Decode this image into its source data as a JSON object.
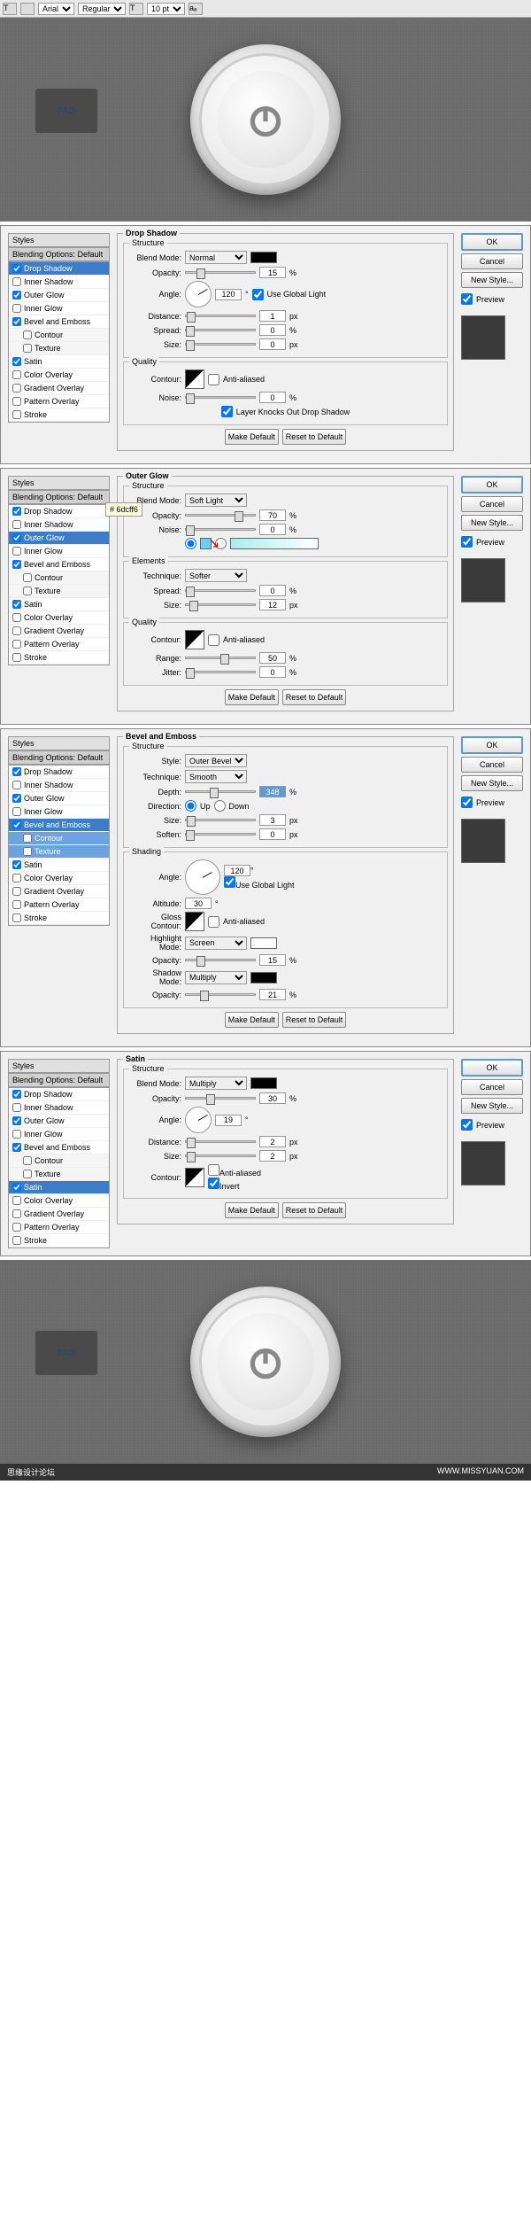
{
  "toolbar": {
    "font": "Arial",
    "weight": "Regular",
    "size": "10 pt"
  },
  "fad": "FAD",
  "panels": [
    {
      "title": "Drop Shadow",
      "active": "Drop Shadow",
      "tooltip": "",
      "styles": [
        {
          "n": "Drop Shadow",
          "c": true,
          "a": true
        },
        {
          "n": "Inner Shadow",
          "c": false
        },
        {
          "n": "Outer Glow",
          "c": true
        },
        {
          "n": "Inner Glow",
          "c": false
        },
        {
          "n": "Bevel and Emboss",
          "c": true
        },
        {
          "n": "Contour",
          "c": false,
          "s": true
        },
        {
          "n": "Texture",
          "c": false,
          "s": true
        },
        {
          "n": "Satin",
          "c": true
        },
        {
          "n": "Color Overlay",
          "c": false
        },
        {
          "n": "Gradient Overlay",
          "c": false
        },
        {
          "n": "Pattern Overlay",
          "c": false
        },
        {
          "n": "Stroke",
          "c": false
        }
      ],
      "struct": {
        "mode": "Normal",
        "opacity": "15",
        "angle": "120",
        "gl": true,
        "dist": "1",
        "spread": "0",
        "size": "0"
      },
      "quality": {
        "noise": "0",
        "knock": true
      }
    },
    {
      "title": "Outer Glow",
      "active": "Outer Glow",
      "tooltip": "# 6dcff6",
      "arrow": true,
      "styles": [
        {
          "n": "Drop Shadow",
          "c": true
        },
        {
          "n": "Inner Shadow",
          "c": false
        },
        {
          "n": "Outer Glow",
          "c": true,
          "a": true
        },
        {
          "n": "Inner Glow",
          "c": false
        },
        {
          "n": "Bevel and Emboss",
          "c": true
        },
        {
          "n": "Contour",
          "c": false,
          "s": true
        },
        {
          "n": "Texture",
          "c": false,
          "s": true
        },
        {
          "n": "Satin",
          "c": true
        },
        {
          "n": "Color Overlay",
          "c": false
        },
        {
          "n": "Gradient Overlay",
          "c": false
        },
        {
          "n": "Pattern Overlay",
          "c": false
        },
        {
          "n": "Stroke",
          "c": false
        }
      ],
      "struct": {
        "mode": "Soft Light",
        "opacity": "70",
        "noise": "0",
        "color": "#6dcff6"
      },
      "elem": {
        "tech": "Softer",
        "spread": "0",
        "size": "12"
      },
      "quality": {
        "range": "50",
        "jitter": "0"
      }
    },
    {
      "title": "Bevel and Emboss",
      "active": "Bevel and Emboss",
      "styles": [
        {
          "n": "Drop Shadow",
          "c": true
        },
        {
          "n": "Inner Shadow",
          "c": false
        },
        {
          "n": "Outer Glow",
          "c": true
        },
        {
          "n": "Inner Glow",
          "c": false
        },
        {
          "n": "Bevel and Emboss",
          "c": true,
          "a": true
        },
        {
          "n": "Contour",
          "c": false,
          "s": true,
          "a": true
        },
        {
          "n": "Texture",
          "c": false,
          "s": true,
          "a": true
        },
        {
          "n": "Satin",
          "c": true
        },
        {
          "n": "Color Overlay",
          "c": false
        },
        {
          "n": "Gradient Overlay",
          "c": false
        },
        {
          "n": "Pattern Overlay",
          "c": false
        },
        {
          "n": "Stroke",
          "c": false
        }
      ],
      "struct": {
        "style": "Outer Bevel",
        "tech": "Smooth",
        "depth": "348",
        "dir": "Up",
        "size": "3",
        "soften": "0"
      },
      "shade": {
        "angle": "120",
        "gl": true,
        "alt": "30",
        "hmode": "Screen",
        "hopac": "15",
        "smode": "Multiply",
        "sopac": "21"
      }
    },
    {
      "title": "Satin",
      "active": "Satin",
      "styles": [
        {
          "n": "Drop Shadow",
          "c": true
        },
        {
          "n": "Inner Shadow",
          "c": false
        },
        {
          "n": "Outer Glow",
          "c": true
        },
        {
          "n": "Inner Glow",
          "c": false
        },
        {
          "n": "Bevel and Emboss",
          "c": true
        },
        {
          "n": "Contour",
          "c": false,
          "s": true
        },
        {
          "n": "Texture",
          "c": false,
          "s": true
        },
        {
          "n": "Satin",
          "c": true,
          "a": true
        },
        {
          "n": "Color Overlay",
          "c": false
        },
        {
          "n": "Gradient Overlay",
          "c": false
        },
        {
          "n": "Pattern Overlay",
          "c": false
        },
        {
          "n": "Stroke",
          "c": false
        }
      ],
      "struct": {
        "mode": "Multiply",
        "opacity": "30",
        "angle": "19",
        "dist": "2",
        "size": "2",
        "aa": false,
        "inv": true
      }
    }
  ],
  "btns": {
    "ok": "OK",
    "cancel": "Cancel",
    "newstyle": "New Style...",
    "preview": "Preview",
    "makedef": "Make Default",
    "resetdef": "Reset to Default"
  },
  "labels": {
    "styles": "Styles",
    "blendopt": "Blending Options: Default",
    "structure": "Structure",
    "quality": "Quality",
    "elements": "Elements",
    "shading": "Shading",
    "blendmode": "Blend Mode:",
    "opacity": "Opacity:",
    "angle": "Angle:",
    "usegl": "Use Global Light",
    "distance": "Distance:",
    "spread": "Spread:",
    "size": "Size:",
    "contour": "Contour:",
    "aa": "Anti-aliased",
    "noise": "Noise:",
    "knock": "Layer Knocks Out Drop Shadow",
    "technique": "Technique:",
    "range": "Range:",
    "jitter": "Jitter:",
    "style": "Style:",
    "depth": "Depth:",
    "direction": "Direction:",
    "up": "Up",
    "down": "Down",
    "soften": "Soften:",
    "altitude": "Altitude:",
    "gloss": "Gloss Contour:",
    "hmode": "Highlight Mode:",
    "smode": "Shadow Mode:",
    "invert": "Invert",
    "px": "px",
    "pct": "%",
    "deg": "°"
  },
  "footer": {
    "left": "思缘设计论坛",
    "right": "WWW.MISSYUAN.COM"
  }
}
